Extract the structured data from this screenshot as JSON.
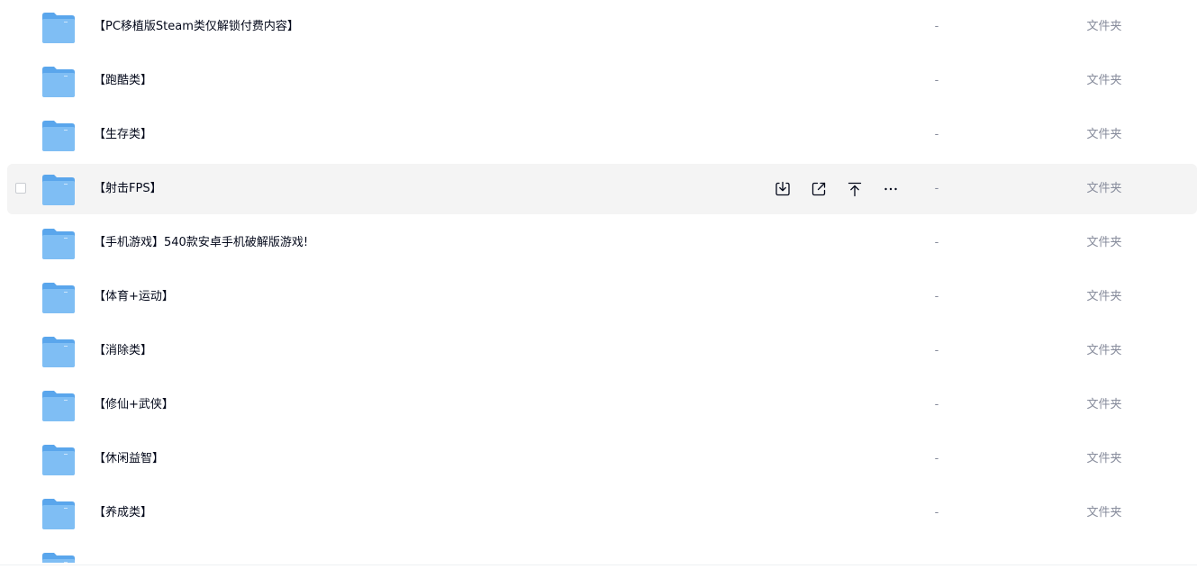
{
  "files": [
    {
      "name": "【PC移植版Steam类仅解锁付费内容】",
      "size": "-",
      "type": "文件夹",
      "hovered": false
    },
    {
      "name": "【跑酷类】",
      "size": "-",
      "type": "文件夹",
      "hovered": false
    },
    {
      "name": "【生存类】",
      "size": "-",
      "type": "文件夹",
      "hovered": false
    },
    {
      "name": "【射击FPS】",
      "size": "-",
      "type": "文件夹",
      "hovered": true
    },
    {
      "name": "【手机游戏】540款安卓手机破解版游戏!",
      "size": "-",
      "type": "文件夹",
      "hovered": false
    },
    {
      "name": "【体育+运动】",
      "size": "-",
      "type": "文件夹",
      "hovered": false
    },
    {
      "name": "【消除类】",
      "size": "-",
      "type": "文件夹",
      "hovered": false
    },
    {
      "name": "【修仙+武侠】",
      "size": "-",
      "type": "文件夹",
      "hovered": false
    },
    {
      "name": "【休闲益智】",
      "size": "-",
      "type": "文件夹",
      "hovered": false
    },
    {
      "name": "【养成类】",
      "size": "-",
      "type": "文件夹",
      "hovered": false
    },
    {
      "name": "",
      "size": "",
      "type": "",
      "hovered": false
    }
  ],
  "row_actions": [
    "download-icon",
    "share-icon",
    "move-to-top-icon",
    "more-icon"
  ],
  "colors": {
    "folder_front": "#7fbef4",
    "folder_back": "#5aa6ec",
    "row_hover_bg": "#f4f4f4",
    "primary_text": "#03081a",
    "secondary_text": "#878c9c"
  }
}
